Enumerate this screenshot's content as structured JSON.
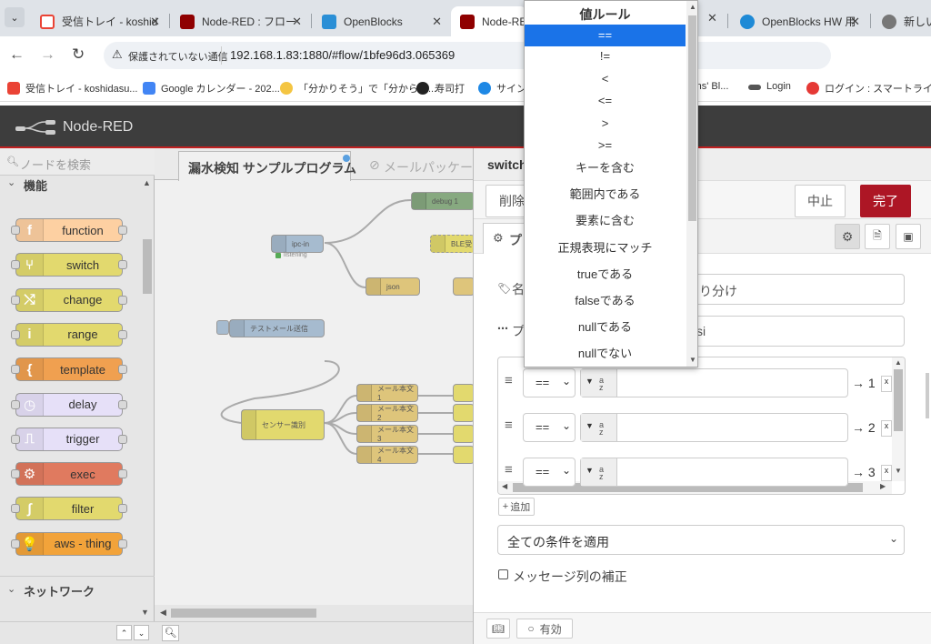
{
  "browser": {
    "tabs": [
      {
        "title": "受信トレイ - koshid",
        "favicon_color": "#ea4335",
        "favicon": "gmail-icon"
      },
      {
        "title": "Node-RED : フロー",
        "favicon_color": "#8f0000",
        "favicon": "node-red-icon"
      },
      {
        "title": "OpenBlocks",
        "favicon_color": "#2a8fd6",
        "favicon": "openblocks-icon"
      },
      {
        "title": "Node-RED : フロー",
        "favicon_color": "#8f0000",
        "favicon": "node-red-icon",
        "active": true
      },
      {
        "title": "OpenBlocks HW 用",
        "favicon_color": "#1e8ad6",
        "favicon": "openblocks-hw-icon"
      },
      {
        "title": "新しいタ",
        "favicon_color": "#777",
        "favicon": "chrome-icon"
      }
    ],
    "security_label": "保護されていない通信",
    "url": "192.168.1.83:1880/#flow/1bfe96d3.065369",
    "bookmarks": [
      {
        "label": "受信トレイ - koshidasu...",
        "color": "#ea4335"
      },
      {
        "label": "Google カレンダー - 202...",
        "color": "#4285f4"
      },
      {
        "label": "「分かりそう」で「分からな...",
        "color": "#f4c542"
      },
      {
        "label": "寿司打",
        "color": "#222"
      },
      {
        "label": "サインイ",
        "color": "#1e88e5"
      },
      {
        "label": "rns' Bl...",
        "color": "#999"
      },
      {
        "label": "Login",
        "color": "#555"
      },
      {
        "label": "ログイン : スマートライト株...",
        "color": "#e53935"
      }
    ]
  },
  "app": {
    "name": "Node-RED"
  },
  "palette": {
    "search_placeholder": "ノードを検索",
    "category_function": "機能",
    "category_network": "ネットワーク",
    "nodes": [
      {
        "label": "function",
        "color": "#fdd0a2",
        "icon": "f"
      },
      {
        "label": "switch",
        "color": "#e2d96e",
        "icon": "⑂"
      },
      {
        "label": "change",
        "color": "#e2d96e",
        "icon": "⤭"
      },
      {
        "label": "range",
        "color": "#e2d96e",
        "icon": "i"
      },
      {
        "label": "template",
        "color": "#f0a050",
        "icon": "{"
      },
      {
        "label": "delay",
        "color": "#e6e0f8",
        "icon": "◷"
      },
      {
        "label": "trigger",
        "color": "#e6e0f8",
        "icon": "⎍"
      },
      {
        "label": "exec",
        "color": "#e07a5f",
        "icon": "⚙"
      },
      {
        "label": "filter",
        "color": "#e2d96e",
        "icon": "∫"
      },
      {
        "label": "aws - thing",
        "color": "#f2a33a",
        "icon": "💡"
      }
    ]
  },
  "workspace": {
    "tabs": [
      "漏水検知 サンプルプログラム",
      "メールパッケー"
    ],
    "nodes": [
      {
        "label": "debug 1",
        "color": "#87a980"
      },
      {
        "label": "ipc-in",
        "color": "#a6bbcf"
      },
      {
        "label": "listening",
        "color": "#5a5"
      },
      {
        "label": "BLE受",
        "color": "#e2d96e"
      },
      {
        "label": "json",
        "color": "#dec57b"
      },
      {
        "label": "テストメール送信",
        "color": "#a6bbcf"
      },
      {
        "label": "センサー識別",
        "color": "#e2d96e"
      },
      {
        "label": "メール本文1",
        "color": "#dec57b"
      },
      {
        "label": "メール本文2",
        "color": "#dec57b"
      },
      {
        "label": "メール本文3",
        "color": "#dec57b"
      },
      {
        "label": "メール本文4",
        "color": "#dec57b"
      }
    ]
  },
  "editor": {
    "title": "switch",
    "delete_label": "削除",
    "cancel_label": "中止",
    "done_label": "完了",
    "properties_tab": "プ",
    "name_label": "名",
    "name_value_suffix": "り分け",
    "property_label": "プ",
    "property_value_suffix": "si",
    "rules": [
      {
        "op": "==",
        "type": "a z",
        "output": "→ 1"
      },
      {
        "op": "==",
        "type": "a z",
        "output": "→ 2"
      },
      {
        "op": "==",
        "type": "a z",
        "output": "→ 3"
      }
    ],
    "add_label": "追加",
    "apply_mode": "全ての条件を適用",
    "recreate_label": "メッセージ列の補正",
    "enabled_label": "有効"
  },
  "dropdown": {
    "header": "値ルール",
    "options": [
      "==",
      "!=",
      "<",
      "<=",
      ">",
      ">=",
      "キーを含む",
      "範囲内である",
      "要素に含む",
      "正規表現にマッチ",
      "trueである",
      "falseである",
      "nullである",
      "nullでない"
    ],
    "selected": "=="
  },
  "colors": {
    "nr_header": "#3d3d3d",
    "accent_red": "#ad1625",
    "selected_blue": "#1a73e8"
  }
}
